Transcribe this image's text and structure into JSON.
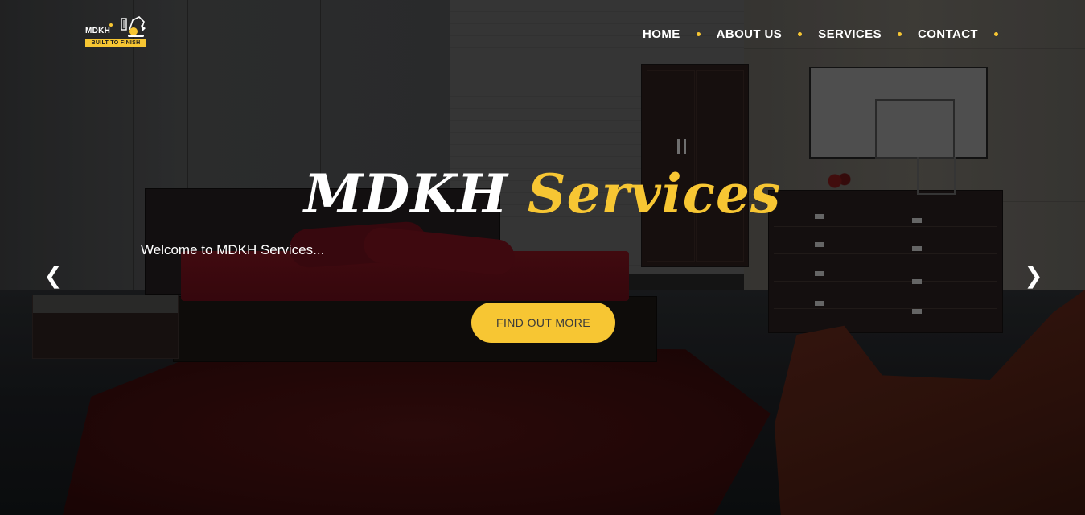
{
  "logo": {
    "text": "MDKH",
    "tagline": "BUILT TO FINISH",
    "accent_color": "#f7c633",
    "icon": "excavator-icon"
  },
  "nav": {
    "items": [
      {
        "label": "HOME"
      },
      {
        "label": "ABOUT US"
      },
      {
        "label": "SERVICES"
      },
      {
        "label": "CONTACT"
      }
    ],
    "separator_color": "#f7c633"
  },
  "hero": {
    "title_part1": "MDKH",
    "title_part2": "Services",
    "welcome": "Welcome to MDKH Services...",
    "cta_label": "FIND OUT MORE",
    "prev_arrow": "❮",
    "next_arrow": "❯",
    "accent_color": "#f7c633",
    "background_image": "dark-bedroom-photo"
  }
}
